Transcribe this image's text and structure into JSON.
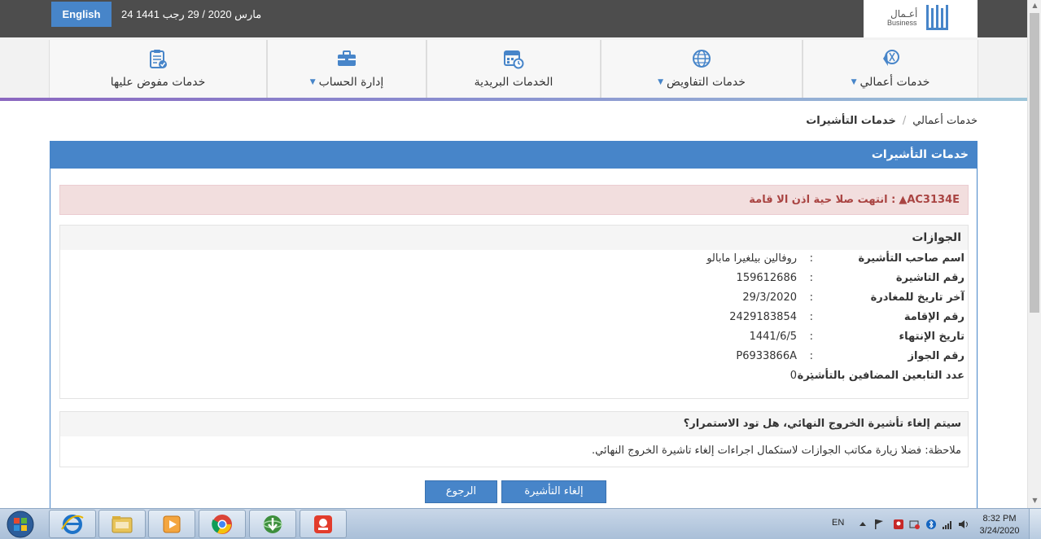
{
  "header": {
    "lang_button": "English",
    "date": "24 مارس 2020 / 29 رجب 1441",
    "logo_ar": "أعـمال",
    "logo_en": "Business"
  },
  "nav": {
    "items": [
      {
        "label": "خدمات أعمالي",
        "icon": "business-icon",
        "dropdown": true
      },
      {
        "label": "خدمات التفاويض",
        "icon": "globe-icon",
        "dropdown": true
      },
      {
        "label": "الخدمات البريدية",
        "icon": "calendar-clock-icon",
        "dropdown": false
      },
      {
        "label": "إدارة الحساب",
        "icon": "briefcase-icon",
        "dropdown": true
      },
      {
        "label": "خدمات مفوض عليها",
        "icon": "clipboard-check-icon",
        "dropdown": false
      }
    ]
  },
  "breadcrumb": {
    "root": "خدمات أعمالي",
    "separator": "/",
    "current": "خدمات التأشيرات"
  },
  "panel": {
    "title": "خدمات التأشيرات",
    "alert": {
      "code": "AC3134E",
      "message": ": انتهت صلا حية اذن الا قامة"
    },
    "section_title": "الجوازات",
    "fields": [
      {
        "label": "اسم صاحب التأشيرة",
        "value": "روفالين بيلغيرا مابالو"
      },
      {
        "label": "رقم التاشيرة",
        "value": "159612686"
      },
      {
        "label": "آخر تاريخ للمغادرة",
        "value": "29/3/2020"
      },
      {
        "label": "رقم الإقامة",
        "value": "2429183854"
      },
      {
        "label": "تاريخ الإنتهاء",
        "value": "1441/6/5"
      },
      {
        "label": "رقم الجواز",
        "value": "P6933866A"
      },
      {
        "label": "عدد التابعين المضافين بالتأشيرة",
        "value": "0"
      }
    ],
    "colon": ":",
    "confirm_question": "سيتم إلغاء تأشيرة الخروج النهائي، هل تود الاستمرار؟",
    "confirm_note": "ملاحظة: فضلا زيارة مكاتب الجوازات لاستكمال اجراءات إلغاء تاشيرة الخروج النهائي.",
    "cancel_visa_button": "إلغاء التأشيرة",
    "back_button": "الرجوع"
  },
  "taskbar": {
    "language": "EN",
    "time": "8:32 PM",
    "date": "3/24/2020"
  },
  "colors": {
    "primary": "#4785c9",
    "alert_bg": "#f2dede",
    "alert_text": "#a94442",
    "topbar": "#4d4d4d"
  }
}
